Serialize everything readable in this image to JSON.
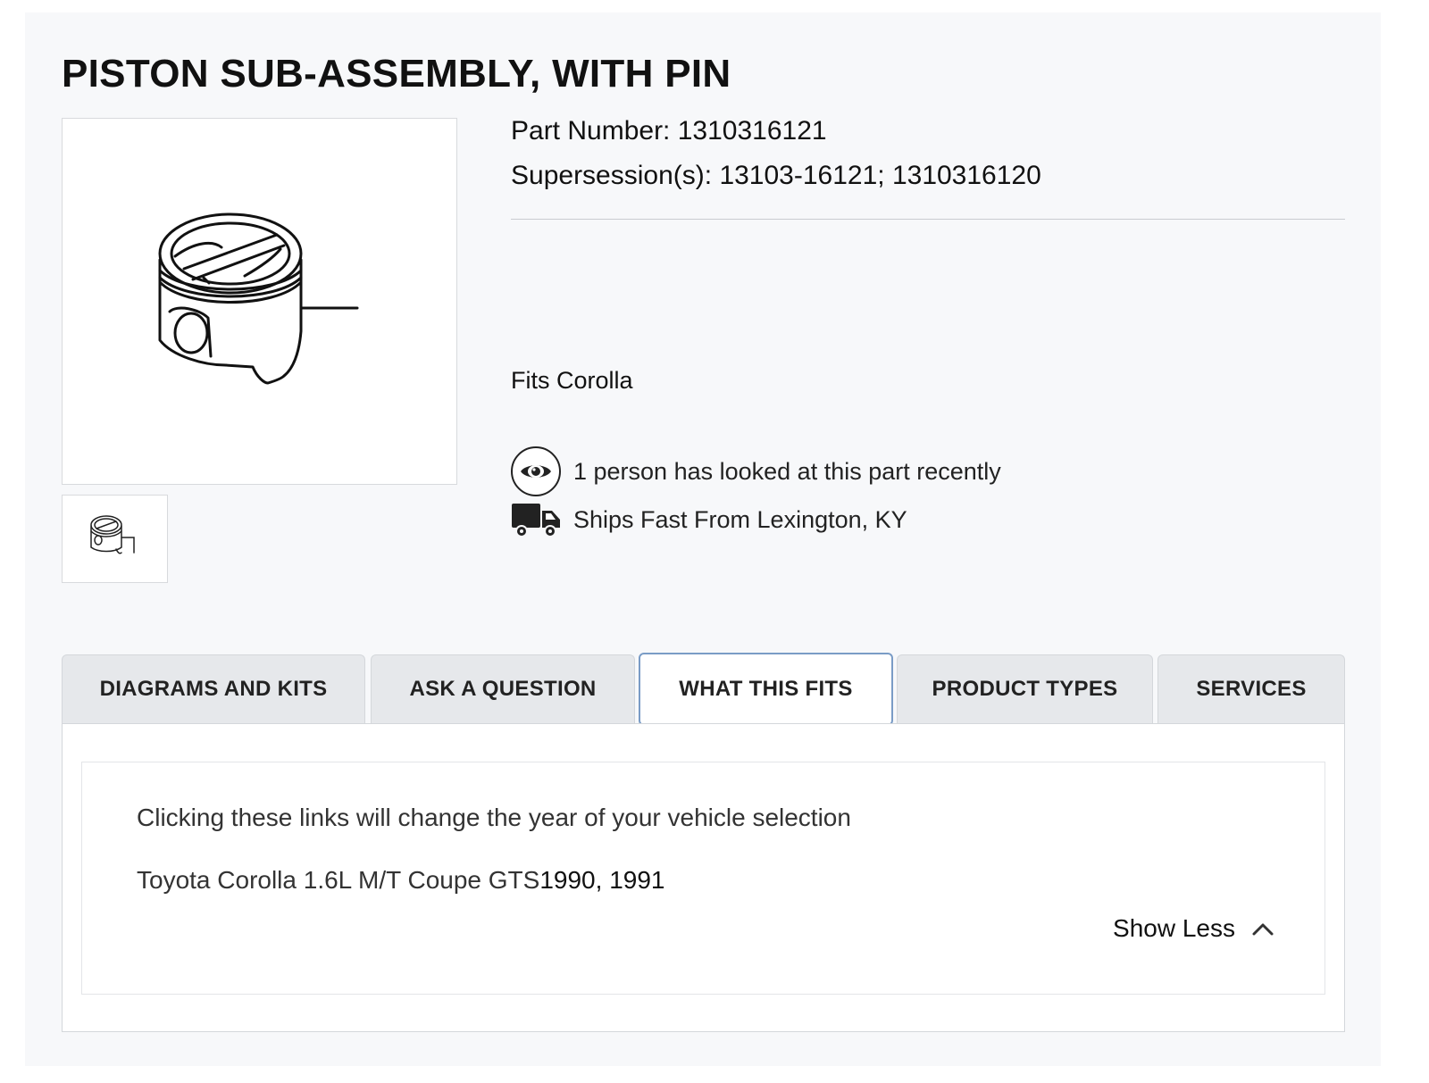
{
  "product": {
    "title": "PISTON SUB-ASSEMBLY, WITH PIN",
    "part_number_label": "Part Number:",
    "part_number": "1310316121",
    "supersession_label": "Supersession(s):",
    "supersessions": "13103-16121; 1310316120",
    "fits": "Fits Corolla"
  },
  "meta": {
    "views_text": "1 person has looked at this part recently",
    "views_icon": "eye-icon",
    "shipping_text": "Ships Fast From Lexington, KY",
    "shipping_icon": "truck-icon"
  },
  "tabs": [
    {
      "label": "DIAGRAMS AND KITS",
      "active": false
    },
    {
      "label": "ASK A QUESTION",
      "active": false
    },
    {
      "label": "WHAT THIS FITS",
      "active": true
    },
    {
      "label": "PRODUCT TYPES",
      "active": false
    },
    {
      "label": "SERVICES",
      "active": false
    }
  ],
  "fitment": {
    "hint": "Clicking these links will change the year of your vehicle selection",
    "vehicle": "Toyota Corolla 1.6L M/T Coupe GTS",
    "years": [
      "1990",
      "1991"
    ],
    "year_separator": ", ",
    "toggle_label": "Show Less",
    "toggle_icon": "chevron-up-icon"
  },
  "colors": {
    "active_tab_border": "#7a9cc6",
    "tab_bg": "#e6e8eb",
    "panel_bg": "#f7f8fa"
  }
}
